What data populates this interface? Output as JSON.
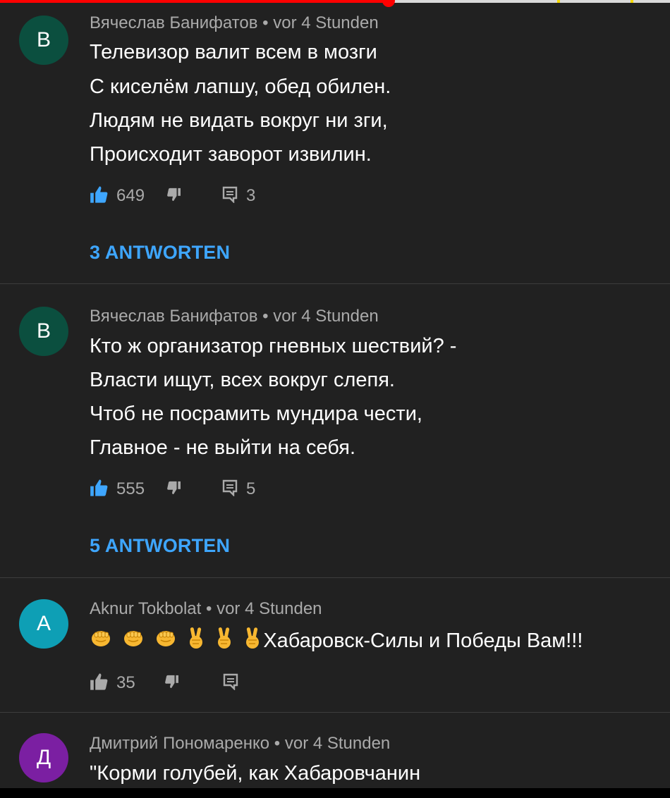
{
  "progress": {
    "played_fraction": 0.58,
    "track_color": "#d9d9d9",
    "played_color": "#ff0000"
  },
  "comments": [
    {
      "avatar_letter": "В",
      "avatar_color": "#0b4f3f",
      "author": "Вячеслав Банифатов",
      "time": "vor 4 Stunden",
      "lines": [
        "Телевизор валит всем в мозги",
        "С киселём лапшу, обед обилен.",
        "Людям не видать вокруг ни зги,",
        "Происходит заворот извилин."
      ],
      "likes": "649",
      "reply_count": "3",
      "replies_label": "3 ANTWORTEN",
      "like_icon": "thumb-up-icon",
      "dislike_icon": "thumb-down-icon",
      "reply_icon": "comment-icon"
    },
    {
      "avatar_letter": "В",
      "avatar_color": "#0b4f3f",
      "author": "Вячеслав Банифатов",
      "time": "vor 4 Stunden",
      "lines": [
        "Кто ж организатор гневных шествий? -",
        "Власти ищут, всех вокруг слепя.",
        "Чтоб не посрамить мундира чести,",
        "Главное - не выйти на себя."
      ],
      "likes": "555",
      "reply_count": "5",
      "replies_label": "5 ANTWORTEN"
    },
    {
      "avatar_letter": "A",
      "avatar_color": "#0e9fb5",
      "author": "Aknur Tokbolat",
      "time": "vor 4 Stunden",
      "emojis": [
        "fist-emoji",
        "fist-emoji",
        "fist-emoji",
        "victory-hand-emoji",
        "victory-hand-emoji",
        "victory-hand-emoji"
      ],
      "text": "Хабаровск-Силы и Победы Вам!!!",
      "likes": "35"
    },
    {
      "avatar_letter": "Д",
      "avatar_color": "#7b1fa2",
      "author": "Дмитрий Пономаренко",
      "time": "vor 4 Stunden",
      "lines": [
        "\"Корми голубей, как Хабаровчанин"
      ]
    }
  ],
  "separator": " • "
}
